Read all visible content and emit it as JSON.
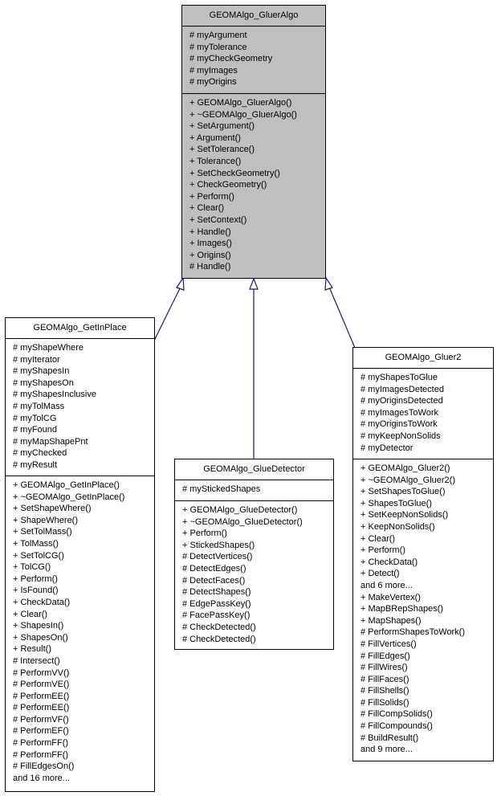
{
  "diagram": {
    "type": "class-inheritance",
    "edge_color": "#191970",
    "base_fill": "#bfbfbf",
    "classes": {
      "base": {
        "name": "GEOMAlgo_GluerAlgo",
        "attributes": [
          "# myArgument",
          "# myTolerance",
          "# myCheckGeometry",
          "# myImages",
          "# myOrigins"
        ],
        "methods": [
          "+ GEOMAlgo_GluerAlgo()",
          "+ ~GEOMAlgo_GluerAlgo()",
          "+ SetArgument()",
          "+ Argument()",
          "+ SetTolerance()",
          "+ Tolerance()",
          "+ SetCheckGeometry()",
          "+ CheckGeometry()",
          "+ Perform()",
          "+ Clear()",
          "+ SetContext()",
          "+ Handle()",
          "+ Images()",
          "+ Origins()",
          "# Handle()"
        ]
      },
      "getinplace": {
        "name": "GEOMAlgo_GetInPlace",
        "attributes": [
          "# myShapeWhere",
          "# myIterator",
          "# myShapesIn",
          "# myShapesOn",
          "# myShapesInclusive",
          "# myTolMass",
          "# myTolCG",
          "# myFound",
          "# myMapShapePnt",
          "# myChecked",
          "# myResult"
        ],
        "methods": [
          "+ GEOMAlgo_GetInPlace()",
          "+ ~GEOMAlgo_GetInPlace()",
          "+ SetShapeWhere()",
          "+ ShapeWhere()",
          "+ SetTolMass()",
          "+ TolMass()",
          "+ SetTolCG()",
          "+ TolCG()",
          "+ Perform()",
          "+ IsFound()",
          "+ CheckData()",
          "+ Clear()",
          "+ ShapesIn()",
          "+ ShapesOn()",
          "+ Result()",
          "# Intersect()",
          "# PerformVV()",
          "# PerformVE()",
          "# PerformEE()",
          "# PerformEE()",
          "# PerformVF()",
          "# PerformEF()",
          "# PerformFF()",
          "# PerformFF()",
          "# FillEdgesOn()",
          "and 16 more..."
        ]
      },
      "gluedetector": {
        "name": "GEOMAlgo_GlueDetector",
        "attributes": [
          "# myStickedShapes"
        ],
        "methods": [
          "+ GEOMAlgo_GlueDetector()",
          "+ ~GEOMAlgo_GlueDetector()",
          "+ Perform()",
          "+ StickedShapes()",
          "# DetectVertices()",
          "# DetectEdges()",
          "# DetectFaces()",
          "# DetectShapes()",
          "# EdgePassKey()",
          "# FacePassKey()",
          "# CheckDetected()",
          "# CheckDetected()"
        ]
      },
      "gluer2": {
        "name": "GEOMAlgo_Gluer2",
        "attributes": [
          "# myShapesToGlue",
          "# myImagesDetected",
          "# myOriginsDetected",
          "# myImagesToWork",
          "# myOriginsToWork",
          "# myKeepNonSolids",
          "# myDetector"
        ],
        "methods": [
          "+ GEOMAlgo_Gluer2()",
          "+ ~GEOMAlgo_Gluer2()",
          "+ SetShapesToGlue()",
          "+ ShapesToGlue()",
          "+ SetKeepNonSolids()",
          "+ KeepNonSolids()",
          "+ Clear()",
          "+ Perform()",
          "+ CheckData()",
          "+ Detect()",
          "and 6 more...",
          "+ MakeVertex()",
          "+ MapBRepShapes()",
          "+ MapShapes()",
          "# PerformShapesToWork()",
          "# FillVertices()",
          "# FillEdges()",
          "# FillWires()",
          "# FillFaces()",
          "# FillShells()",
          "# FillSolids()",
          "# FillCompSolids()",
          "# FillCompounds()",
          "# BuildResult()",
          "and 9 more..."
        ]
      }
    },
    "edges": [
      {
        "from": "getinplace",
        "to": "base",
        "kind": "inherits"
      },
      {
        "from": "gluedetector",
        "to": "base",
        "kind": "inherits"
      },
      {
        "from": "gluer2",
        "to": "base",
        "kind": "inherits"
      }
    ]
  }
}
